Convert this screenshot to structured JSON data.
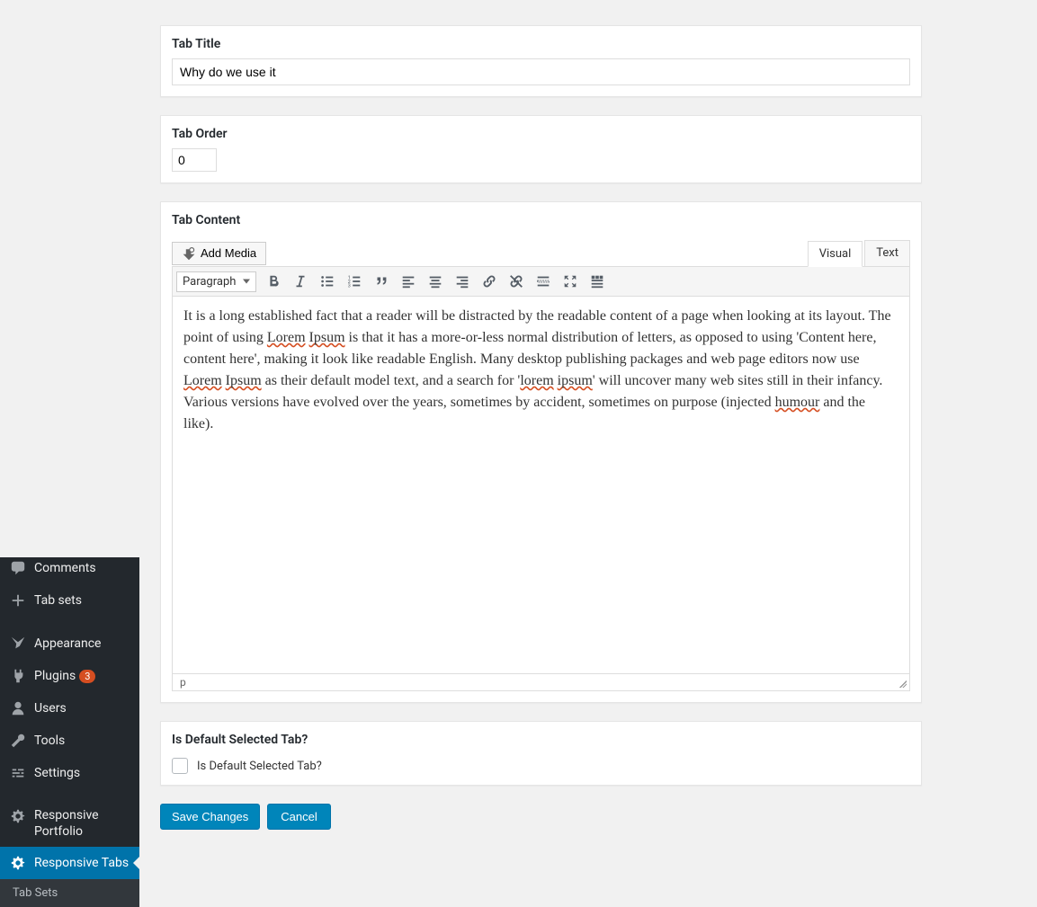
{
  "sidebar": {
    "items": [
      {
        "label": "Comments"
      },
      {
        "label": "Tab sets"
      },
      {
        "label": "Appearance"
      },
      {
        "label": "Plugins",
        "badge": "3"
      },
      {
        "label": "Users"
      },
      {
        "label": "Tools"
      },
      {
        "label": "Settings"
      },
      {
        "label": "Responsive Portfolio"
      },
      {
        "label": "Responsive Tabs"
      }
    ],
    "sub": {
      "label": "Tab Sets"
    }
  },
  "panels": {
    "tab_title": {
      "heading": "Tab Title",
      "value": "Why do we use it"
    },
    "tab_order": {
      "heading": "Tab Order",
      "value": "0"
    },
    "tab_content": {
      "heading": "Tab Content",
      "add_media": "Add Media",
      "tabs": {
        "visual": "Visual",
        "text": "Text"
      },
      "format": "Paragraph",
      "body_parts": [
        "It is a long established fact that a reader will be distracted by the readable content of a page when looking at its layout. The point of using ",
        "Lorem",
        " ",
        "Ipsum",
        " is that it has a more-or-less normal distribution of letters, as opposed to using 'Content here, content here', making it look like readable English. Many desktop publishing packages and web page editors now use ",
        "Lorem",
        " ",
        "Ipsum",
        " as their default model text, and a search for '",
        "lorem",
        " ",
        "ipsum",
        "' will uncover many web sites still in their infancy. Various versions have evolved over the years, sometimes by accident, sometimes on purpose (injected ",
        "humour",
        " and the like)."
      ],
      "path": "p"
    },
    "default_tab": {
      "heading": "Is Default Selected Tab?",
      "label": "Is Default Selected Tab?"
    }
  },
  "actions": {
    "save": "Save Changes",
    "cancel": "Cancel"
  }
}
